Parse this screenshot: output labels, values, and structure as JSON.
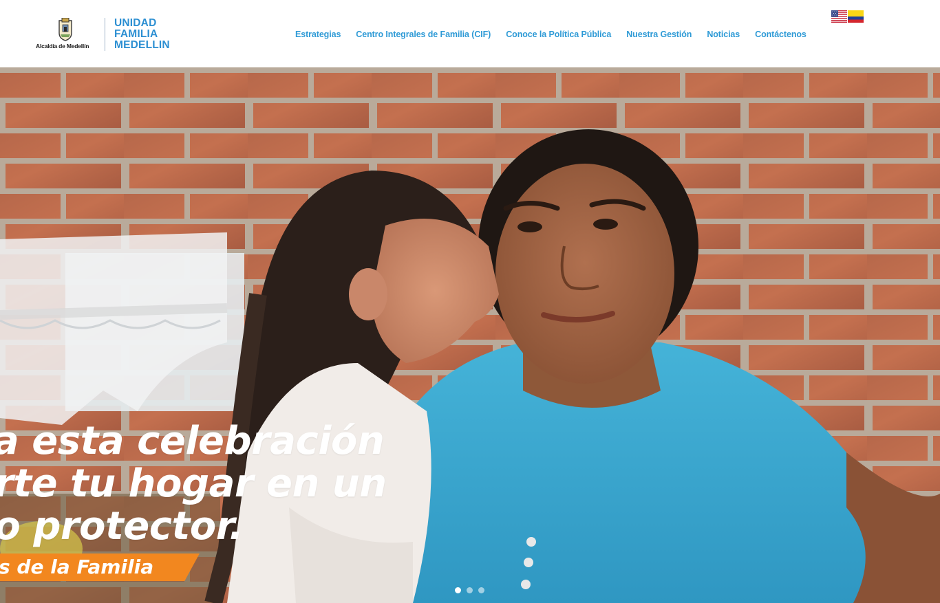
{
  "header": {
    "alcaldia_label": "Alcaldía de Medellín",
    "brand_lines": [
      "UNIDAD",
      "FAMILIA",
      "MEDELLIN"
    ]
  },
  "nav": {
    "items": [
      {
        "label": "Estrategias"
      },
      {
        "label": "Centro Integrales de Familia (CIF)"
      },
      {
        "label": "Conoce la Política Pública"
      },
      {
        "label": "Nuestra Gestión"
      },
      {
        "label": "Noticias"
      },
      {
        "label": "Contáctenos"
      }
    ]
  },
  "languages": [
    {
      "icon": "us-flag-icon",
      "name": "English"
    },
    {
      "icon": "colombia-flag-icon",
      "name": "Español"
    }
  ],
  "hero": {
    "lines": [
      "a esta celebración",
      "vierte tu hogar en un",
      "no protector."
    ],
    "ribbon": "s de la Familia",
    "slide_count": 3,
    "active_slide": 1
  },
  "colors": {
    "nav_link": "#2e9ad6",
    "brand_blue": "#2c8fd2",
    "ribbon_orange": "#f2871f"
  }
}
